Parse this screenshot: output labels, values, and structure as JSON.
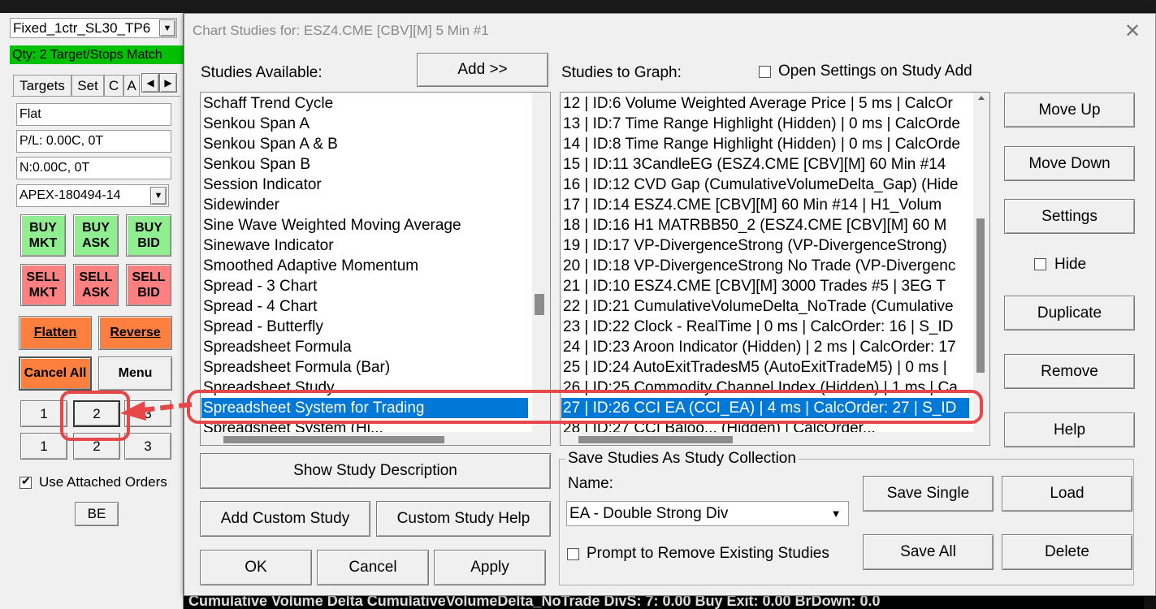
{
  "left_panel": {
    "strategy_select": "Fixed_1ctr_SL30_TP6",
    "status_bar": "Qty: 2 Target/Stops Match",
    "tabs": [
      "Targets",
      "Set",
      "C",
      "A"
    ],
    "position_field": "Flat",
    "pl_field": "P/L: 0.00C, 0T",
    "n_field": "N:0.00C, 0T",
    "account_select": "APEX-180494-14",
    "buy_buttons": [
      {
        "line1": "BUY",
        "line2": "MKT"
      },
      {
        "line1": "BUY",
        "line2": "ASK"
      },
      {
        "line1": "BUY",
        "line2": "BID"
      }
    ],
    "sell_buttons": [
      {
        "line1": "SELL",
        "line2": "MKT"
      },
      {
        "line1": "SELL",
        "line2": "ASK"
      },
      {
        "line1": "SELL",
        "line2": "BID"
      }
    ],
    "flatten": "Flatten",
    "reverse": "Reverse",
    "cancel_all": "Cancel All",
    "menu": "Menu",
    "qty_row1": [
      "1",
      "2",
      "3"
    ],
    "qty_row2": [
      "1",
      "2",
      "3"
    ],
    "use_attached_orders": "Use Attached Orders",
    "be": "BE"
  },
  "dialog": {
    "title": "Chart Studies for: ESZ4.CME [CBV][M]  5 Min  #1",
    "studies_available_label": "Studies Available:",
    "add_button": "Add >>",
    "studies_available": [
      "Schaff Trend Cycle",
      "Senkou Span A",
      "Senkou Span A & B",
      "Senkou Span B",
      "Session Indicator",
      "Sidewinder",
      "Sine Wave Weighted Moving Average",
      "Sinewave Indicator",
      "Smoothed Adaptive Momentum",
      "Spread - 3 Chart",
      "Spread - 4 Chart",
      "Spread - Butterfly",
      "Spreadsheet Formula",
      "Spreadsheet Formula (Bar)",
      "Spreadsheet Study",
      "Spreadsheet System for Trading",
      "Spreadsheet System (Hi..."
    ],
    "studies_to_graph_label": "Studies to Graph:",
    "open_settings_label": "Open Settings on Study Add",
    "studies_to_graph": [
      "12 | ID:6  Volume Weighted Average Price | 5 ms | CalcOr",
      "13 | ID:7  Time Range Highlight (Hidden) | 0 ms | CalcOrde",
      "14 | ID:8  Time Range Highlight (Hidden) | 0 ms | CalcOrde",
      "15 | ID:11  3CandleEG (ESZ4.CME [CBV][M]  60 Min  #14",
      "16 | ID:12  CVD Gap (CumulativeVolumeDelta_Gap) (Hide",
      "17 | ID:14  ESZ4.CME [CBV][M]  60 Min  #14 | H1_Volum",
      "18 | ID:16  H1 MATRBB50_2 (ESZ4.CME [CBV][M]  60 M",
      "19 | ID:17  VP-DivergenceStrong (VP-DivergenceStrong)",
      "20 | ID:18  VP-DivergenceStrong No Trade (VP-Divergenc",
      "21 | ID:10  ESZ4.CME [CBV][M]  3000 Trades #5 | 3EG T",
      "22 | ID:21  CumulativeVolumeDelta_NoTrade (Cumulative",
      "23 | ID:22  Clock - RealTime | 0 ms | CalcOrder: 16 | S_ID",
      "24 | ID:23  Aroon Indicator (Hidden) | 2 ms | CalcOrder: 17",
      "25 | ID:24  AutoExitTradesM5 (AutoExitTradeM5) | 0 ms |",
      "26 | ID:25  Commodity Channel Index (Hidden) | 1 ms | Ca",
      "27 | ID:26  CCI EA (CCI_EA) | 4 ms | CalcOrder: 27 | S_ID",
      "28 | ID:27  CCI Baloo... (Hidden) | CalcOrder..."
    ],
    "right_buttons": {
      "move_up": "Move Up",
      "move_down": "Move Down",
      "settings": "Settings",
      "hide": "Hide",
      "duplicate": "Duplicate",
      "remove": "Remove",
      "help": "Help"
    },
    "show_study_description": "Show Study Description",
    "add_custom_study": "Add Custom Study",
    "custom_study_help": "Custom Study Help",
    "ok": "OK",
    "cancel": "Cancel",
    "apply": "Apply",
    "collection": {
      "group_label": "Save Studies As Study Collection",
      "name_label": "Name:",
      "name_value": "EA - Double Strong Div",
      "save_single": "Save Single",
      "load": "Load",
      "save_all": "Save All",
      "delete": "Delete",
      "prompt_remove": "Prompt to Remove Existing Studies"
    }
  },
  "background_text": "Cumulative Volume Delta  CumulativeVolumeDelta_NoTrade  DivS: 7: 0.00   Buy Exit: 0.00  BrDown: 0.0",
  "colors": {
    "selection": "#0078d7",
    "buy": "#90ee90",
    "sell": "#ff8080",
    "orange": "#ff7f3f",
    "status_green": "#00c000",
    "annotation_red": "#e8474a"
  }
}
